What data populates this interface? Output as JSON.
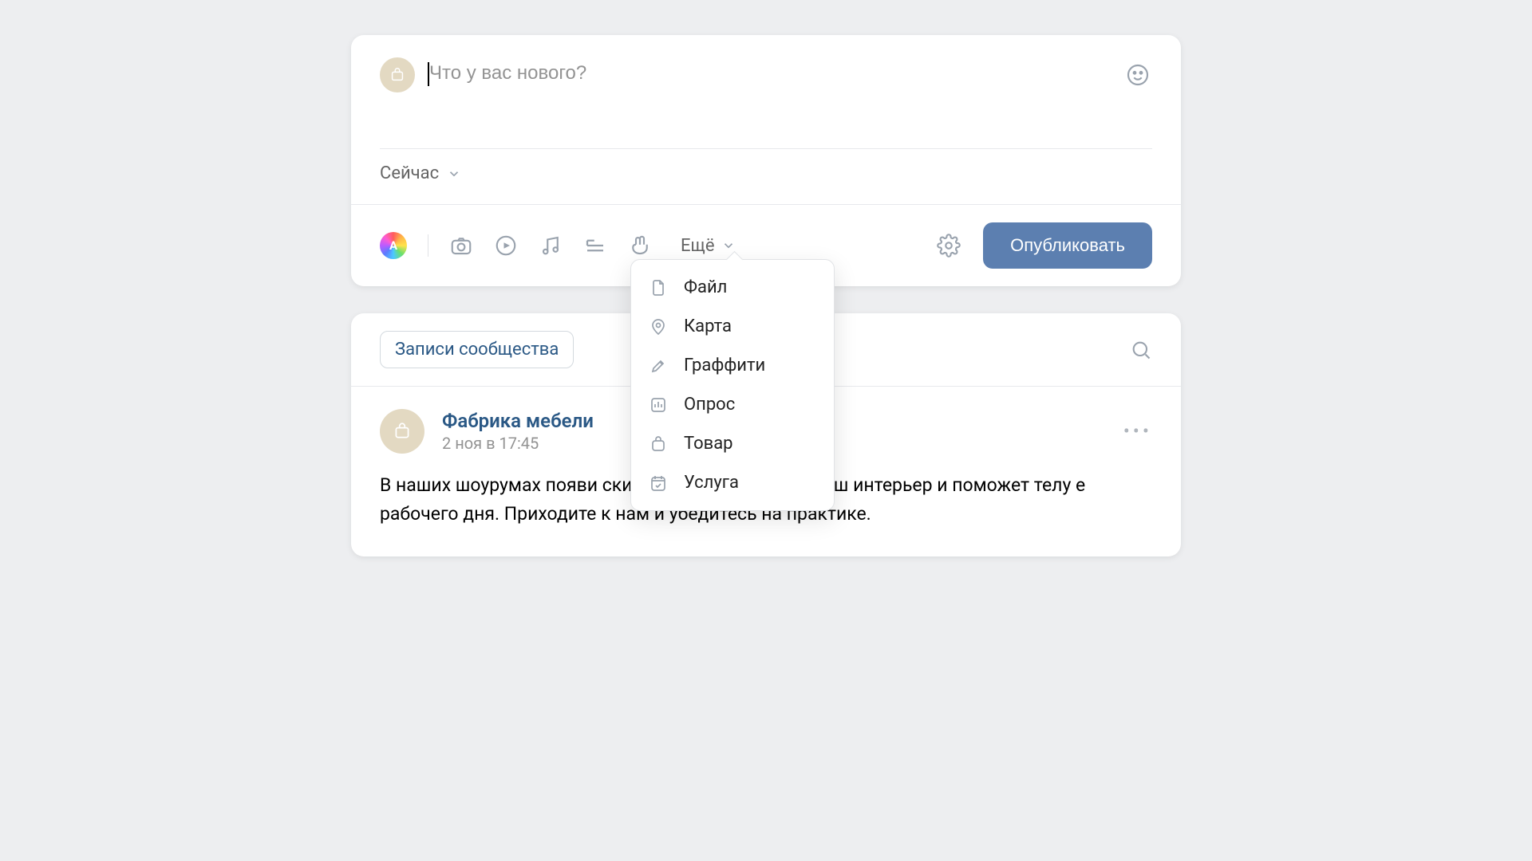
{
  "composer": {
    "placeholder": "Что у вас нового?",
    "schedule_label": "Сейчас",
    "more_label": "Ещё",
    "publish_label": "Опубликовать",
    "ai_letter": "A"
  },
  "dropdown": {
    "items": [
      {
        "label": "Файл"
      },
      {
        "label": "Карта"
      },
      {
        "label": "Граффити"
      },
      {
        "label": "Опрос"
      },
      {
        "label": "Товар"
      },
      {
        "label": "Услуга"
      }
    ]
  },
  "feed": {
    "tab_label": "Записи сообщества"
  },
  "post": {
    "author": "Фабрика мебели",
    "timestamp": "2 ноя в 17:45",
    "body": "В наших шоурумах появи                                       ских форм! Она украсит ваш интерьер и поможет телу                                 е рабочего дня. Приходите к нам и убедитесь на практике."
  }
}
